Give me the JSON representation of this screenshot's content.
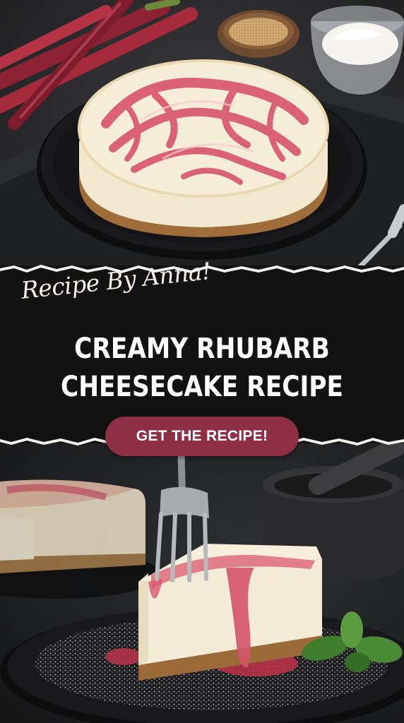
{
  "banner": {
    "subtitle": "Recipe By Anna!",
    "title_line1": "CREAMY RHUBARB",
    "title_line2": "CHEESECAKE RECIPE"
  },
  "cta": {
    "label": "GET THE RECIPE!"
  },
  "colors": {
    "banner_background": "#121212",
    "cta_background": "#8e2f45",
    "text": "#ffffff"
  }
}
